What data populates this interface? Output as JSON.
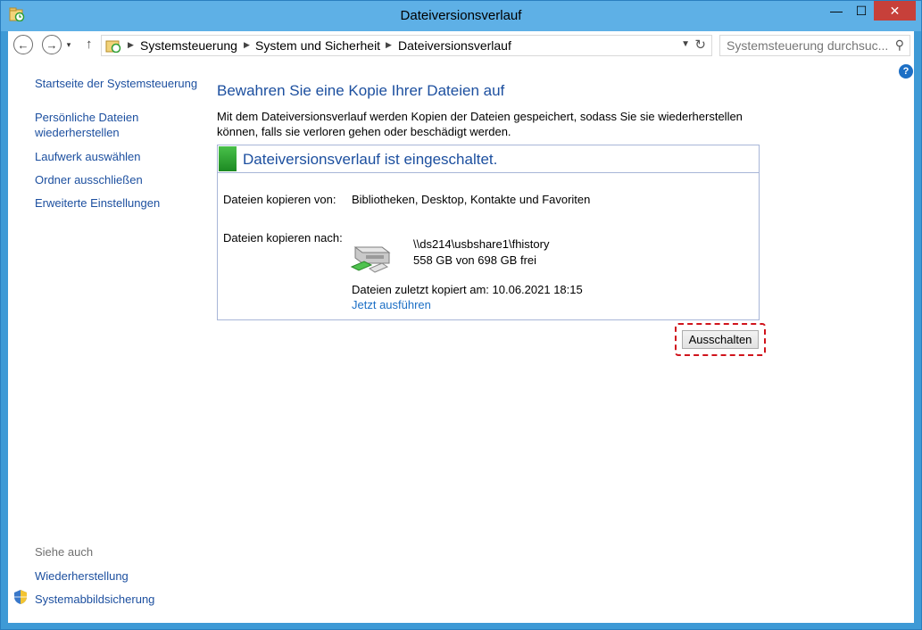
{
  "window": {
    "title": "Dateiversionsverlauf",
    "controls": {
      "minimize": "—",
      "maximize": "☐",
      "close": "✕"
    }
  },
  "toolbar": {
    "back_icon": "arrow-left-icon",
    "forward_icon": "arrow-right-icon",
    "up_icon": "arrow-up-icon",
    "breadcrumbs": [
      "Systemsteuerung",
      "System und Sicherheit",
      "Dateiversionsverlauf"
    ],
    "search_placeholder": "Systemsteuerung durchsuc..."
  },
  "sidebar": {
    "home_link": "Startseite der Systemsteuerung",
    "tasks": [
      "Persönliche Dateien\nwiederherstellen",
      "Laufwerk auswählen",
      "Ordner ausschließen",
      "Erweiterte Einstellungen"
    ],
    "see_also_heading": "Siehe auch",
    "see_also": [
      "Wiederherstellung",
      "Systemabbildsicherung"
    ]
  },
  "main": {
    "heading": "Bewahren Sie eine Kopie Ihrer Dateien auf",
    "description": "Mit dem Dateiversionsverlauf werden Kopien der Dateien gespeichert, sodass Sie sie wiederherstellen können, falls sie verloren gehen oder beschädigt werden.",
    "status": {
      "title": "Dateiversionsverlauf ist eingeschaltet.",
      "color": "#2e9e34",
      "copy_from_label": "Dateien kopieren von:",
      "copy_from_value": "Bibliotheken, Desktop, Kontakte und Favoriten",
      "copy_to_label": "Dateien kopieren nach:",
      "drive_path": "\\\\ds214\\usbshare1\\fhistory",
      "drive_space": "558 GB von 698 GB frei",
      "last_copied": "Dateien zuletzt kopiert am: 10.06.2021 18:15",
      "run_now_link": "Jetzt ausführen"
    },
    "turn_off_button": "Ausschalten"
  },
  "colors": {
    "accent": "#1c4f9f",
    "link": "#1c6fc5",
    "highlight": "#d0141c",
    "titlebar": "#5eb0e6"
  }
}
